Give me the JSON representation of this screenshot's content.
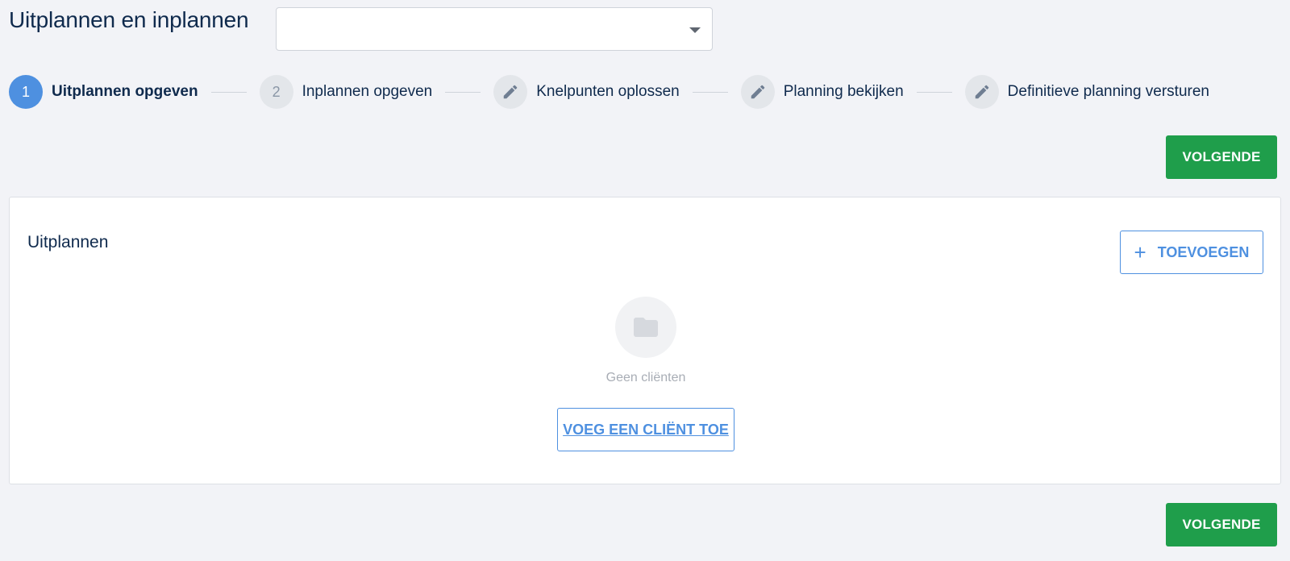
{
  "header": {
    "title": "Uitplannen en inplannen",
    "select": {
      "value": "",
      "icon": "chevron-down-icon"
    }
  },
  "stepper": {
    "steps": [
      {
        "number": "1",
        "label": "Uitplannen opgeven",
        "state": "active"
      },
      {
        "number": "2",
        "label": "Inplannen opgeven",
        "state": "inactive"
      },
      {
        "icon": "pencil-icon",
        "label": "Knelpunten oplossen",
        "state": "inactive"
      },
      {
        "icon": "pencil-icon",
        "label": "Planning bekijken",
        "state": "inactive"
      },
      {
        "icon": "pencil-icon",
        "label": "Definitieve planning versturen",
        "state": "inactive"
      }
    ]
  },
  "actions": {
    "next_label": "VOLGENDE"
  },
  "card": {
    "title": "Uitplannen",
    "add_label": "TOEVOEGEN",
    "add_icon": "plus-icon",
    "empty_icon": "folder-icon",
    "empty_text": "Geen cliënten",
    "add_client_label": "VOEG EEN CLIËNT TOE"
  },
  "colors": {
    "primary": "#4e90e0",
    "success": "#1f9e4b",
    "text": "#0f2a4d",
    "background": "#f2f3f7"
  }
}
